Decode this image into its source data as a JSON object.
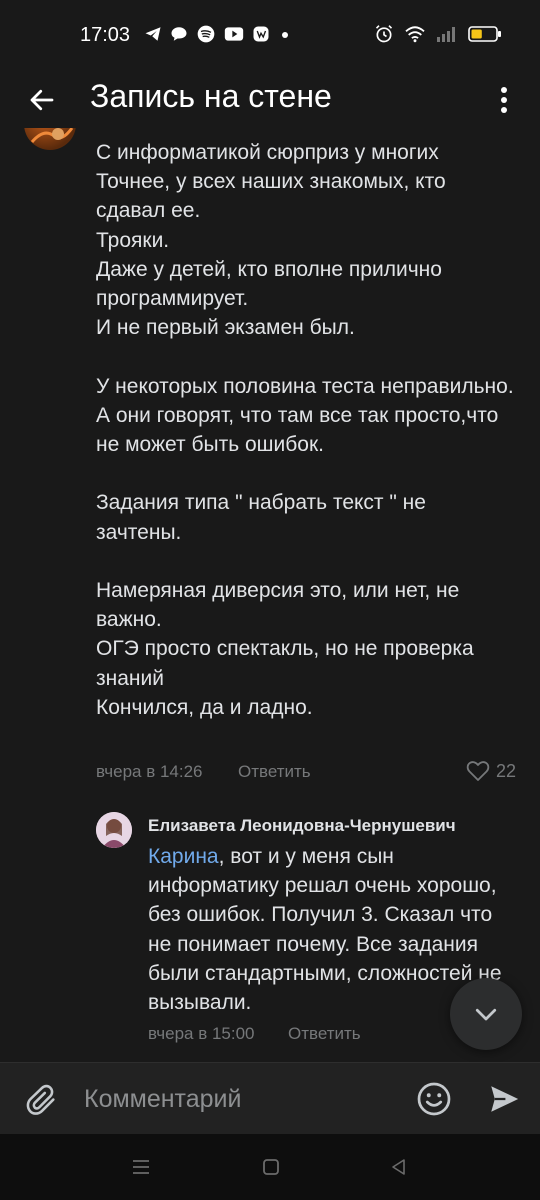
{
  "status_bar": {
    "time": "17:03",
    "icons_left": [
      "telegram-icon",
      "chat-icon",
      "spotify-icon",
      "youtube-icon",
      "vk-icon",
      "dot-icon"
    ],
    "icons_right": [
      "alarm-icon",
      "wifi-icon",
      "signal-icon",
      "battery-icon"
    ],
    "battery_level": 0.45
  },
  "app_bar": {
    "title": "Запись на стене",
    "back_icon": "arrow-left-icon",
    "more_icon": "more-vertical-icon"
  },
  "comment": {
    "text": "С информатикой сюрприз у многих\nТочнее, у всех наших знакомых, кто сдавал ее.\nТрояки.\nДаже у детей, кто вполне прилично программирует.\nИ не первый экзамен был.\n\nУ некоторых половина теста неправильно.\nА они говорят, что там все так просто,что не может быть ошибок.\n\nЗадания типа \" набрать текст \" не зачтены.\n\nНамеряная диверсия это, или нет, не важно.\nОГЭ просто спектакль, но не проверка знаний\nКончился, да и ладно.",
    "time": "вчера в 14:26",
    "reply_label": "Ответить",
    "likes": "22"
  },
  "reply": {
    "author": "Елизавета Леонидовна-Чернушевич",
    "mention": "Карина",
    "text": ",  вот и у меня сын информатику решал очень хорошо, без ошибок. Получил 3. Сказал что не понимает почему. Все задания были стандартными, сложностей не вызывали.",
    "time": "вчера в 15:00",
    "reply_label": "Ответить"
  },
  "composer": {
    "placeholder": "Комментарий"
  },
  "colors": {
    "background": "#191919",
    "text": "#e1e3e6",
    "secondary": "#76787a",
    "link": "#71aaeb"
  }
}
